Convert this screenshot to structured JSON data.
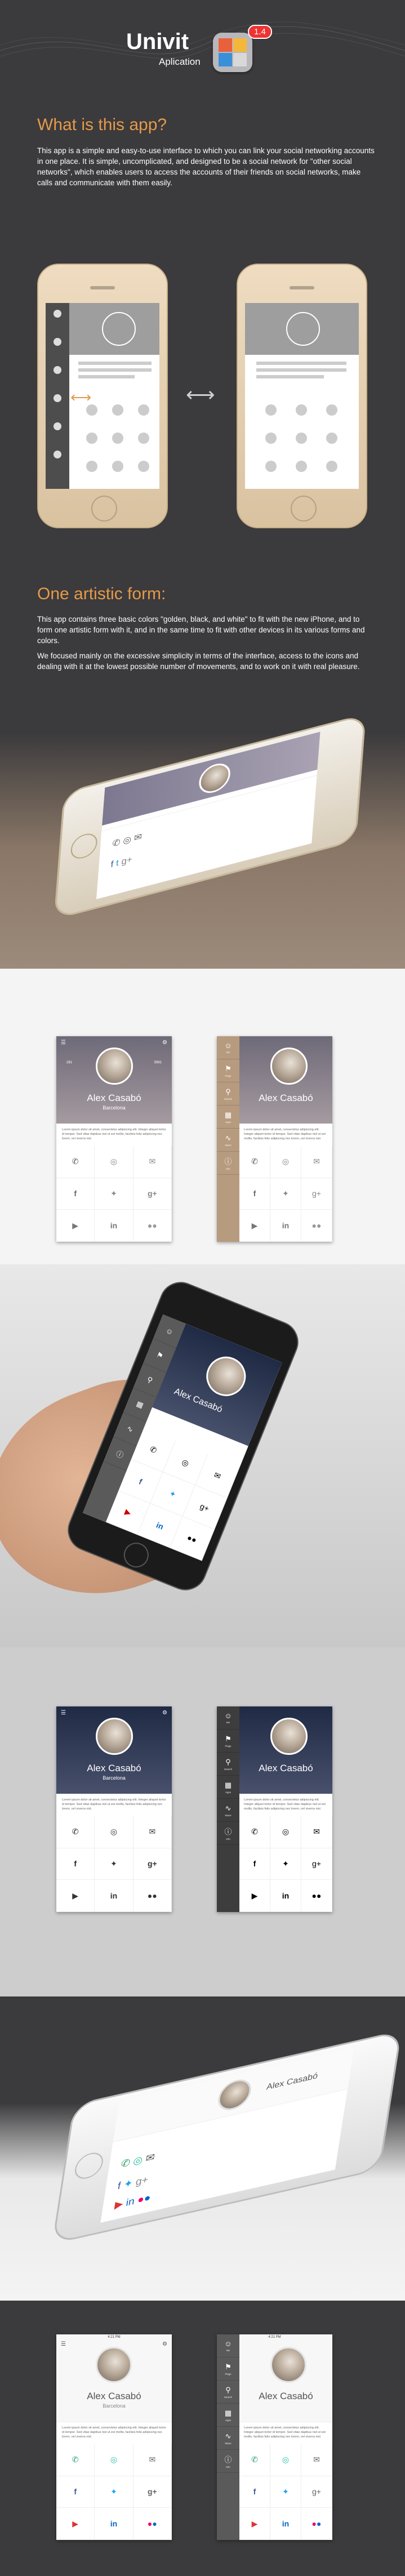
{
  "header": {
    "logo_title": "Univit",
    "logo_subtitle": "Aplication",
    "badge": "1.4"
  },
  "section1": {
    "title": "What is this app?",
    "para": "This app is a simple and easy-to-use interface to which you can link your social networking accounts in one place. It is simple, uncomplicated, and designed to be a social network for \"other social networks\", which enables users to access the accounts of their friends on social networks, make calls and communicate with them easily.",
    "swap_icon": "double-arrow-icon"
  },
  "section2": {
    "title": "One artistic form:",
    "para1": "This app contains three basic colors \"golden, black, and white\" to fit with the new iPhone, and to form one artistic form with it, and in the same time to fit with other devices in its various forms and colors.",
    "para2": "We focused mainly on the excessive simplicity in terms of the interface, access to the icons and dealing with it at the lowest possible number of movements, and to work on it with real pleasure."
  },
  "profile": {
    "name": "Alex Casabó",
    "city": "Barcelona",
    "stat_left_num": "281",
    "stat_left_label": "Followers",
    "stat_right_num": "5981",
    "stat_right_label": "Following",
    "bio": "Lorem ipsum dolor sit amet, consectetur adipiscing elit. Integer aliquet tortor id tempor. Sed vitae dapibus nisl ut est mollis, facilisis felis adipiscing nec lorem, vel viverra nisl.",
    "time": "4:21 PM"
  },
  "menu": {
    "items": [
      "Me",
      "Flags",
      "Search",
      "Apps",
      "Wave",
      "Info"
    ]
  },
  "grid_icons": [
    "phone-icon",
    "globe-icon",
    "mail-icon",
    "facebook-icon",
    "twitter-icon",
    "google-plus-icon",
    "youtube-icon",
    "linkedin-icon",
    "flickr-icon"
  ],
  "colors": {
    "background_dark": "#3b3a3c",
    "accent_orange": "#e59a4a",
    "gold_header": "#8c8498",
    "black_header": "#27324e",
    "grey_section": "#cdcdcd",
    "brown_section": "#8a7767"
  }
}
